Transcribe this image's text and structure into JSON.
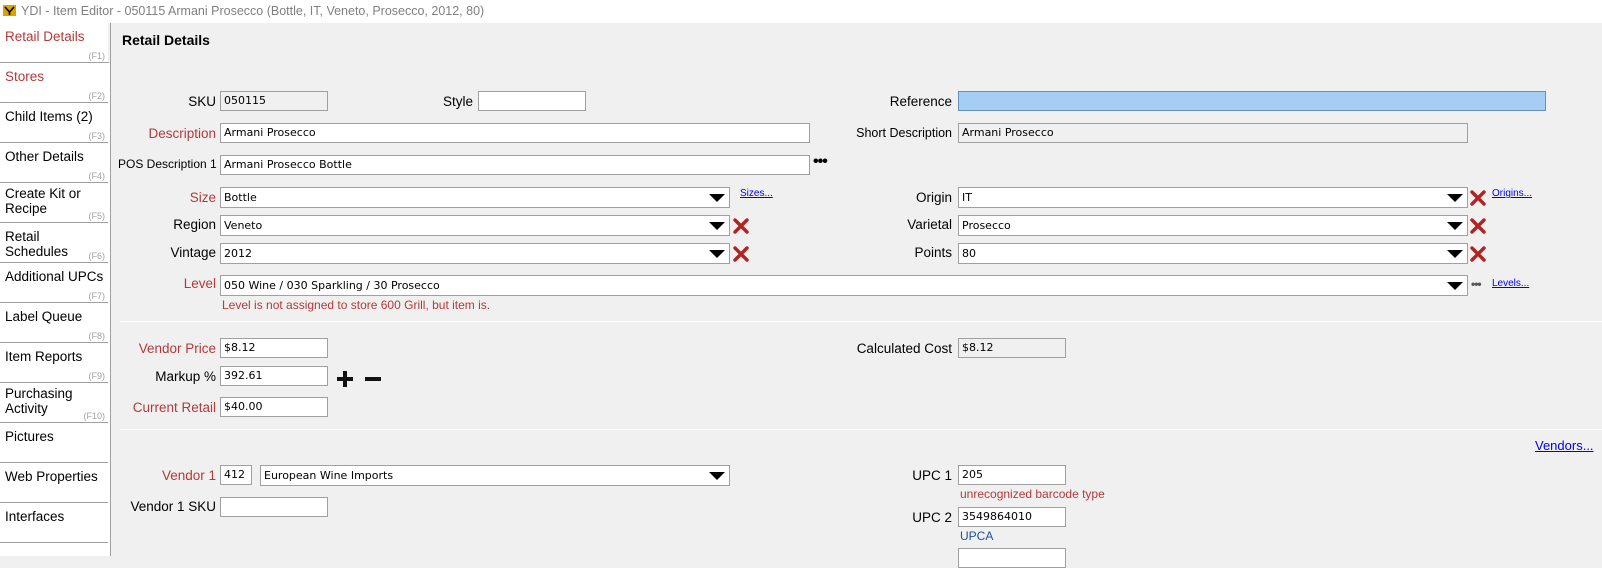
{
  "window": {
    "title": "YDI - Item Editor - 050115 Armani Prosecco (Bottle, IT, Veneto, Prosecco, 2012, 80)"
  },
  "sidebar": {
    "items": [
      {
        "label": "Retail Details",
        "key": "(F1)"
      },
      {
        "label": "Stores",
        "key": "(F2)"
      },
      {
        "label": "Child Items (2)",
        "key": "(F3)"
      },
      {
        "label": "Other Details",
        "key": "(F4)"
      },
      {
        "label": "Create Kit or Recipe",
        "key": "(F5)"
      },
      {
        "label": "Retail Schedules",
        "key": "(F6)"
      },
      {
        "label": "Additional UPCs",
        "key": "(F7)"
      },
      {
        "label": "Label Queue",
        "key": "(F8)"
      },
      {
        "label": "Item Reports",
        "key": "(F9)"
      },
      {
        "label": "Purchasing Activity",
        "key": "(F10)"
      },
      {
        "label": "Pictures",
        "key": ""
      },
      {
        "label": "Web Properties",
        "key": ""
      },
      {
        "label": "Interfaces",
        "key": ""
      }
    ]
  },
  "form": {
    "heading": "Retail Details",
    "sku": {
      "label": "SKU",
      "value": "050115"
    },
    "style": {
      "label": "Style",
      "value": ""
    },
    "reference": {
      "label": "Reference",
      "value": ""
    },
    "description": {
      "label": "Description",
      "value": "Armani Prosecco"
    },
    "short_description": {
      "label": "Short Description",
      "value": "Armani Prosecco"
    },
    "pos_description": {
      "label": "POS Description 1",
      "value": "Armani Prosecco Bottle"
    },
    "size": {
      "label": "Size",
      "value": "Bottle",
      "link": "Sizes..."
    },
    "origin": {
      "label": "Origin",
      "value": "IT",
      "link": "Origins..."
    },
    "region": {
      "label": "Region",
      "value": "Veneto"
    },
    "varietal": {
      "label": "Varietal",
      "value": "Prosecco"
    },
    "vintage": {
      "label": "Vintage",
      "value": "2012"
    },
    "points": {
      "label": "Points",
      "value": "80"
    },
    "level": {
      "label": "Level",
      "value": "050 Wine / 030 Sparkling / 30 Prosecco",
      "link": "Levels...",
      "error": "Level is not assigned to store 600 Grill, but item is."
    },
    "vendor_price": {
      "label": "Vendor Price",
      "value": "$8.12"
    },
    "calculated_cost": {
      "label": "Calculated Cost",
      "value": "$8.12"
    },
    "markup": {
      "label": "Markup %",
      "value": "392.61"
    },
    "current_retail": {
      "label": "Current Retail",
      "value": "$40.00"
    },
    "vendors_link": "Vendors...",
    "vendor1": {
      "label": "Vendor 1",
      "code": "412",
      "name": "European Wine Imports"
    },
    "vendor1_sku": {
      "label": "Vendor 1 SKU",
      "value": ""
    },
    "upc1": {
      "label": "UPC 1",
      "value": "205",
      "note": "unrecognized barcode type"
    },
    "upc2": {
      "label": "UPC 2",
      "value": "3549864010",
      "note": "UPCA"
    }
  }
}
